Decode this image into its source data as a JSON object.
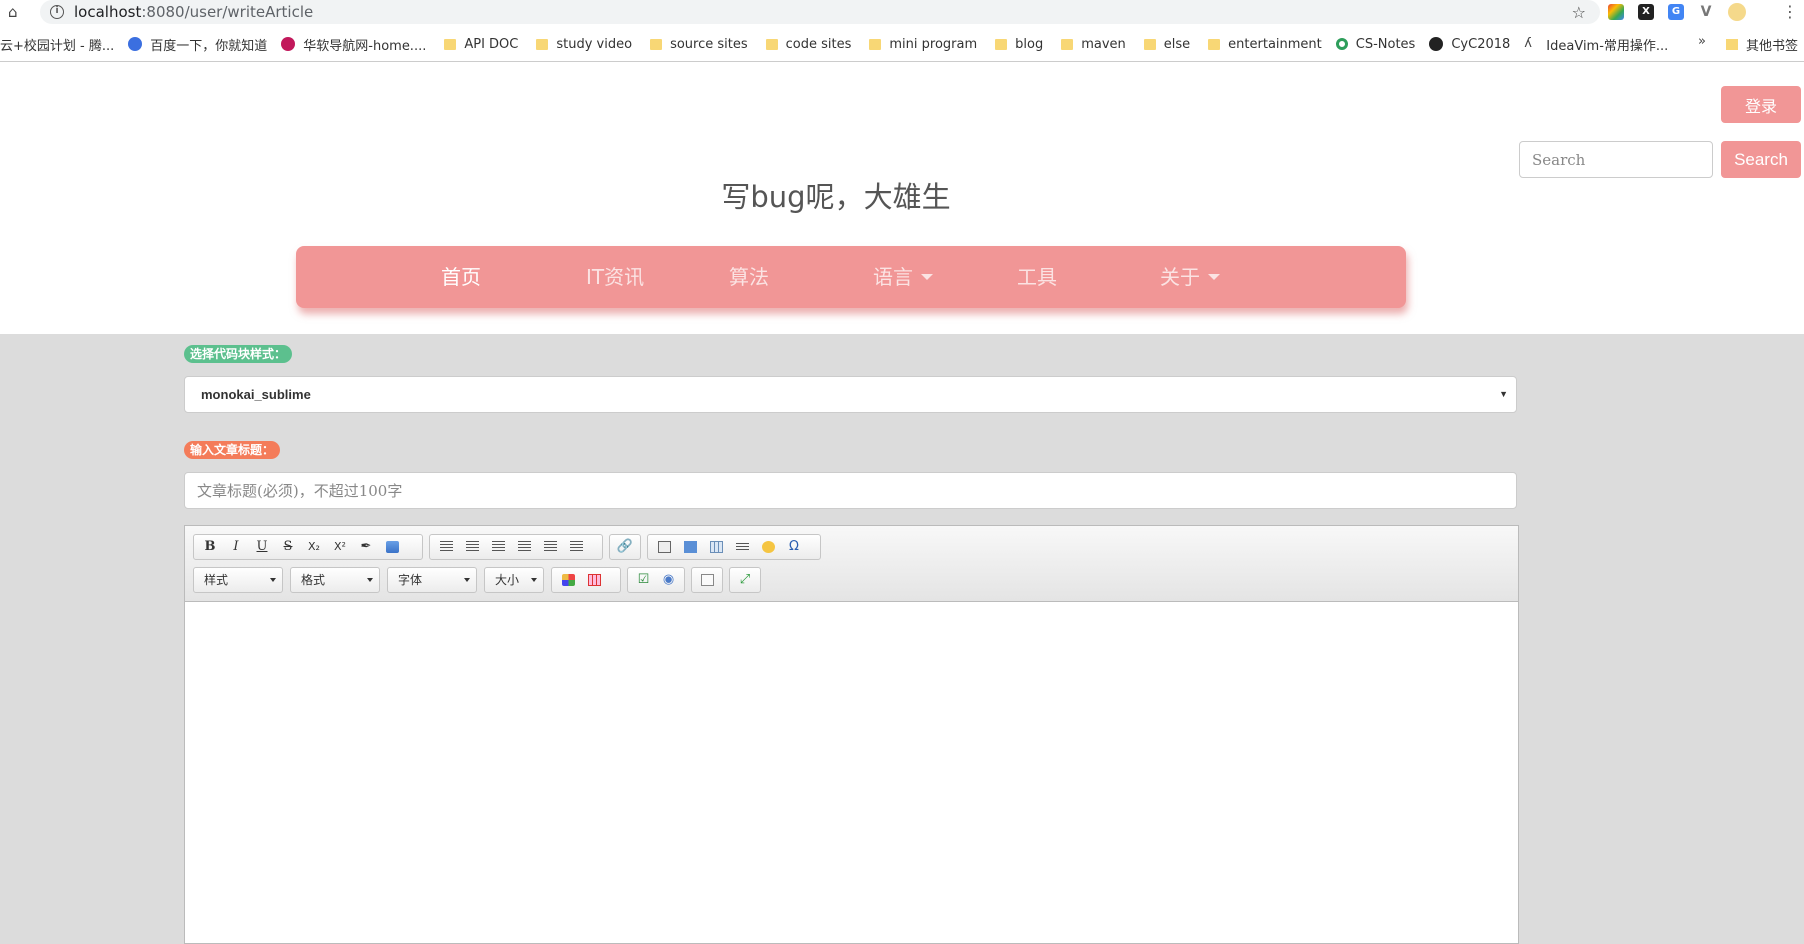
{
  "browser": {
    "url_host": "localhost",
    "url_rest": ":8080/user/writeArticle",
    "bookmarks": [
      {
        "label": "云+校园计划 - 腾...",
        "icon": "tencent-icon"
      },
      {
        "label": "百度一下，你就知道",
        "icon": "baidu-icon"
      },
      {
        "label": "华软导航网-home....",
        "icon": "huaruan-icon"
      },
      {
        "label": "API DOC",
        "icon": "folder-icon"
      },
      {
        "label": "study video",
        "icon": "folder-icon"
      },
      {
        "label": "source sites",
        "icon": "folder-icon"
      },
      {
        "label": "code sites",
        "icon": "folder-icon"
      },
      {
        "label": "mini program",
        "icon": "folder-icon"
      },
      {
        "label": "blog",
        "icon": "folder-icon"
      },
      {
        "label": "maven",
        "icon": "folder-icon"
      },
      {
        "label": "else",
        "icon": "folder-icon"
      },
      {
        "label": "entertainment",
        "icon": "folder-icon"
      },
      {
        "label": "CS-Notes",
        "icon": "cs-notes-icon"
      },
      {
        "label": "CyC2018",
        "icon": "github-icon"
      },
      {
        "label": "IdeaVim-常用操作...",
        "icon": "ideavim-icon"
      }
    ],
    "bookmarks_more": "»",
    "other_bookmarks": "其他书签"
  },
  "header": {
    "login_label": "登录",
    "search_placeholder": "Search",
    "search_button": "Search",
    "site_title": "写bug呢，大雄生"
  },
  "nav": {
    "items": [
      {
        "label": "首页"
      },
      {
        "label": "IT资讯"
      },
      {
        "label": "算法"
      },
      {
        "label": "语言"
      },
      {
        "label": "工具"
      },
      {
        "label": "关于"
      }
    ]
  },
  "form": {
    "code_style_label": "选择代码块样式：",
    "code_style_selected": "monokai_sublime",
    "title_label": "输入文章标题：",
    "title_placeholder": "文章标题(必须)，不超过100字"
  },
  "editor": {
    "combos": [
      "样式",
      "格式",
      "字体",
      "大小"
    ],
    "toolbar": {
      "bold": "B",
      "italic": "I",
      "underline": "U",
      "strike": "S",
      "subscript": "X₂",
      "superscript": "X²",
      "special_char": "Ω"
    }
  },
  "colors": {
    "accent": "#f19696",
    "content_bg": "#dcdcdc",
    "label_green": "#5cc08e",
    "label_orange": "#f47c5a"
  }
}
